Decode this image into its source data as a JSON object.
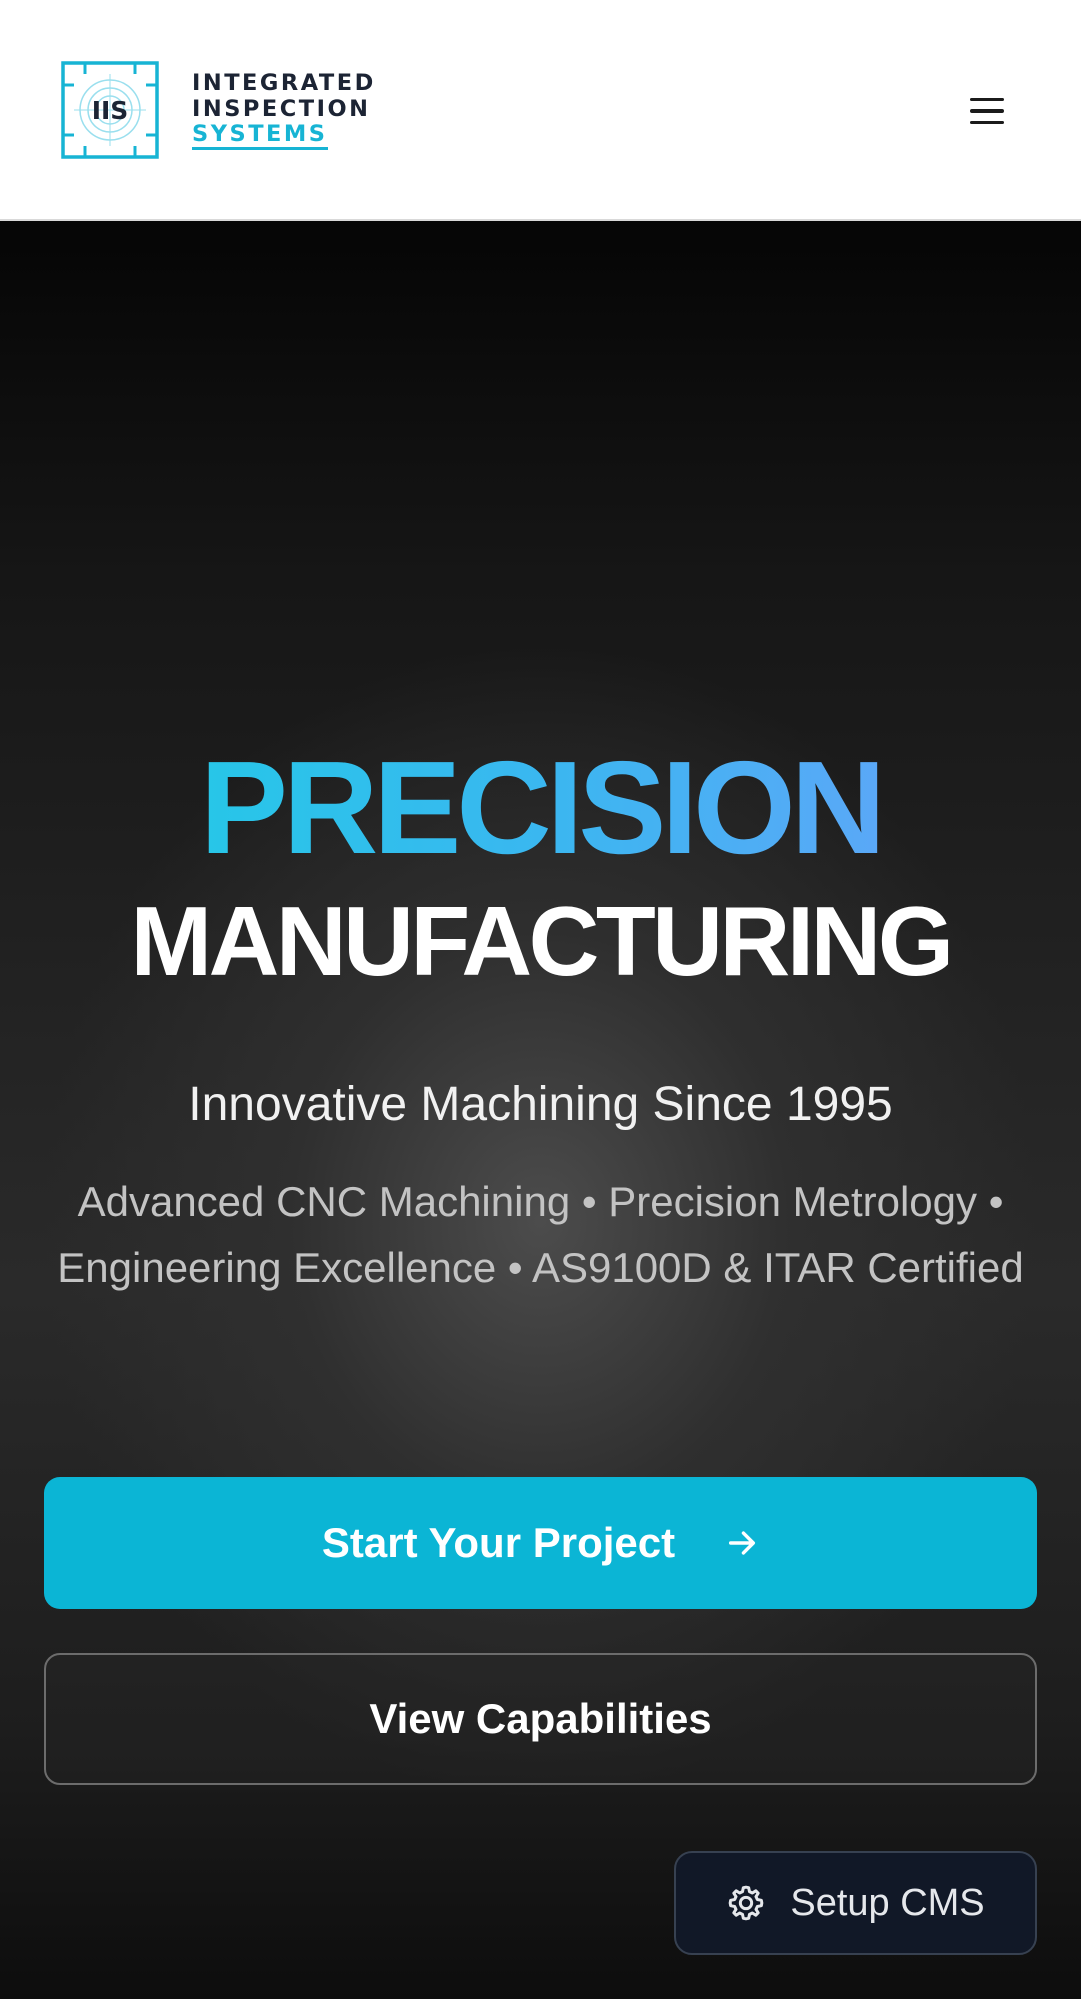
{
  "header": {
    "logo": {
      "mark_text": "IIS",
      "line1": "INTEGRATED",
      "line2": "INSPECTION",
      "line3": "SYSTEMS"
    },
    "menu_icon": "hamburger-menu-icon"
  },
  "hero": {
    "title_line1": "PRECISION",
    "title_line2": "MANUFACTURING",
    "subtitle": "Innovative Machining Since 1995",
    "description": "Advanced CNC Machining • Precision Metrology • Engineering Excellence • AS9100D & ITAR Certified",
    "primary_button": {
      "label": "Start Your Project",
      "icon": "arrow-right-icon"
    },
    "secondary_button": {
      "label": "View Capabilities"
    },
    "cms_button": {
      "label": "Setup CMS",
      "icon": "gear-icon"
    }
  },
  "colors": {
    "accent": "#0bb5d5",
    "logo_teal": "#17b4d4",
    "logo_navy": "#1c2434",
    "gradient_start": "#27c6e8",
    "gradient_end": "#5aa8f7",
    "cms_bg": "#111827"
  }
}
